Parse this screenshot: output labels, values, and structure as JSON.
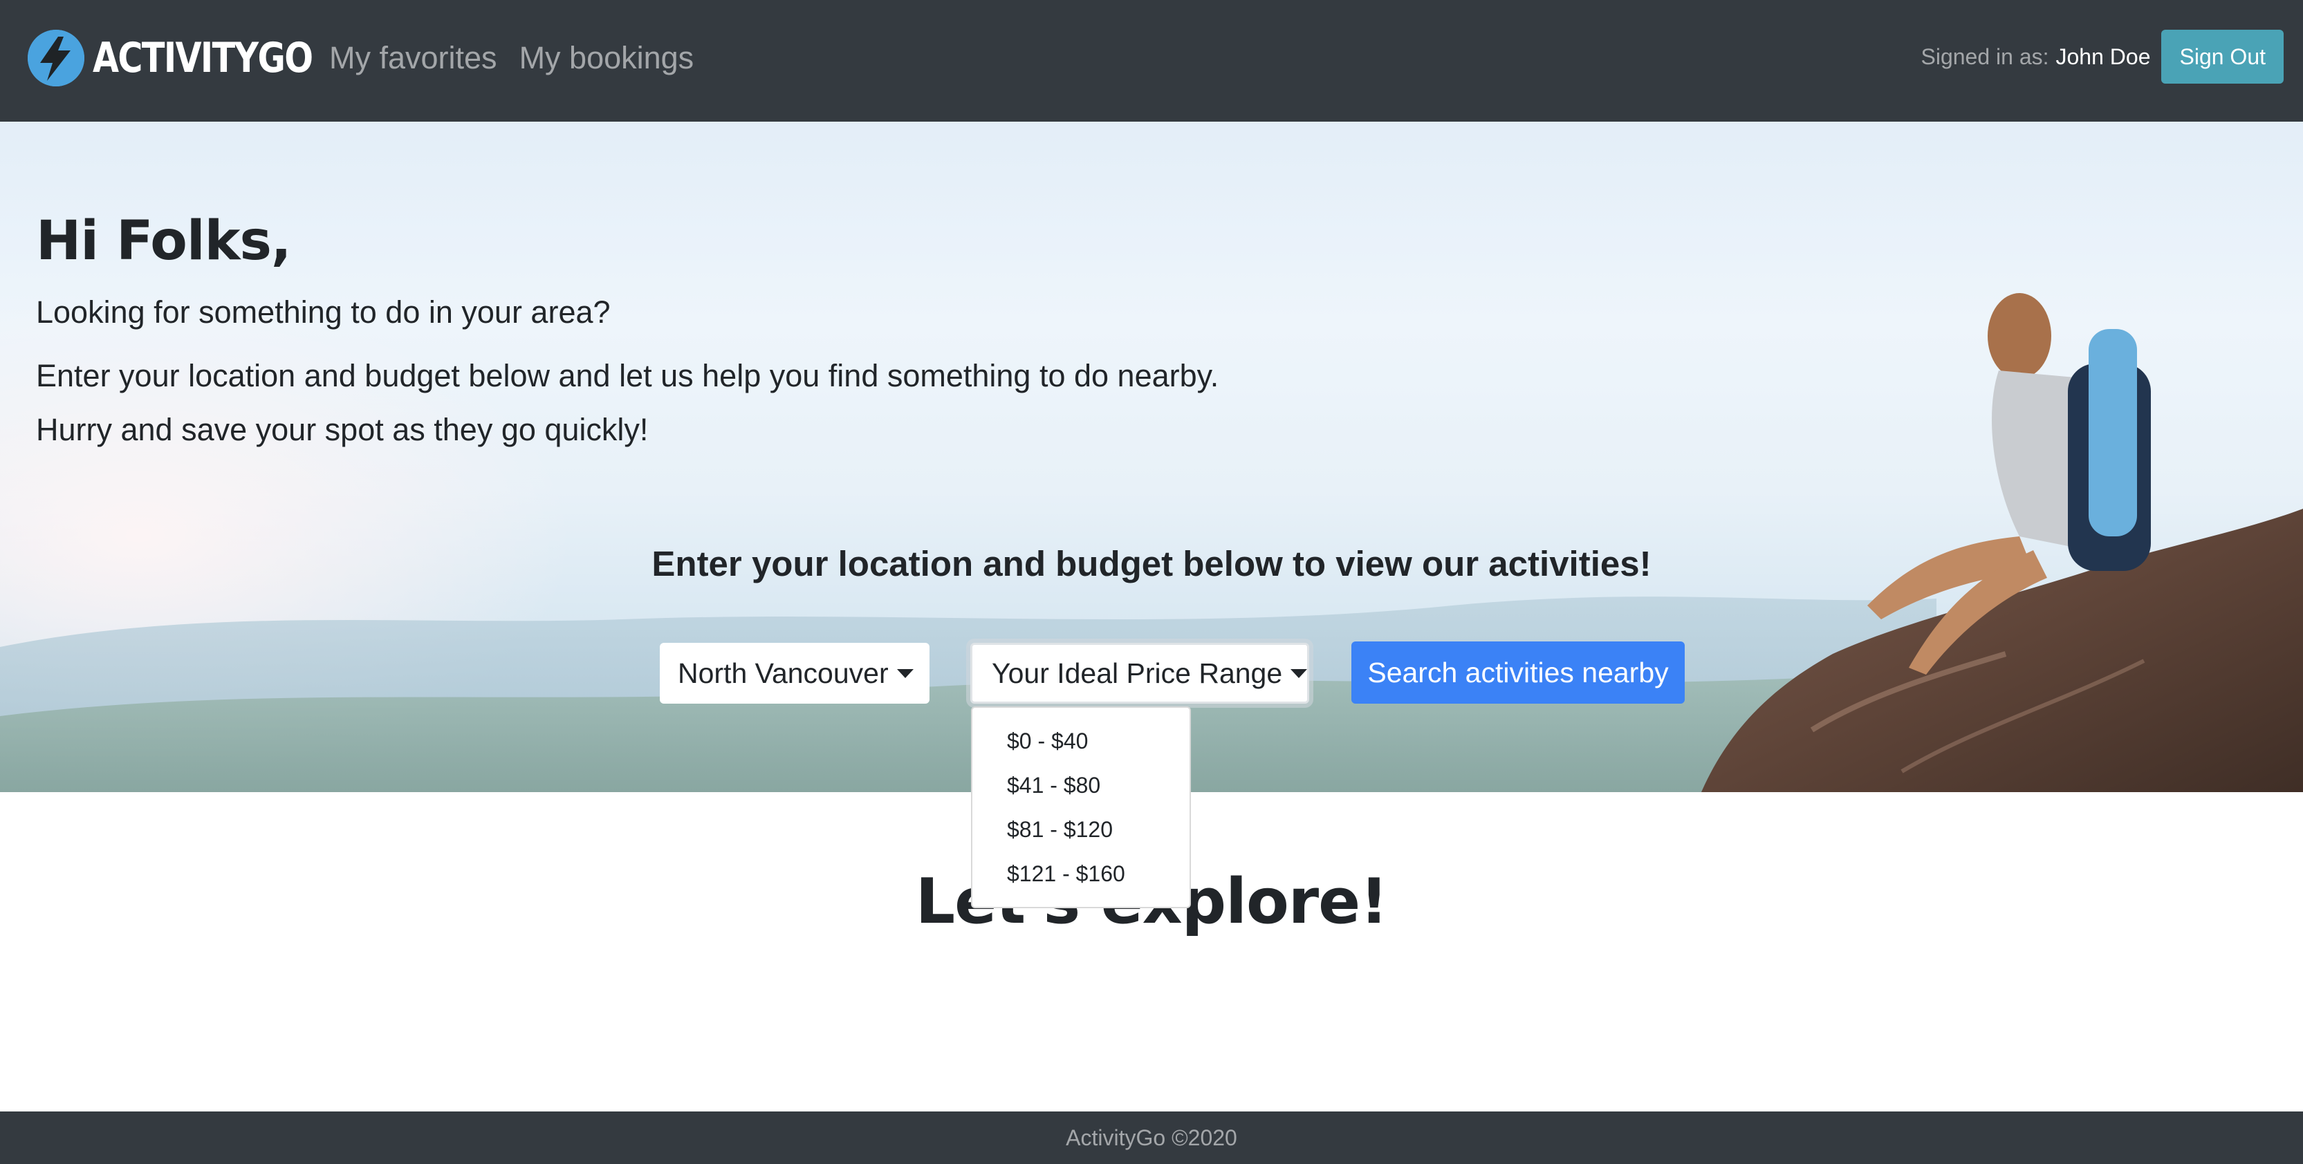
{
  "navbar": {
    "brand": "ACTIVITYGO",
    "links": [
      "My favorites",
      "My bookings"
    ],
    "signed_in_label": "Signed in as:",
    "user_name": "John Doe",
    "sign_out_label": "Sign Out"
  },
  "hero": {
    "title": "Hi Folks,",
    "subtitle": "Looking for something to do in your area?",
    "paragraph_1": "Enter your location and budget below and let us help you find something to do nearby.",
    "paragraph_2": "Hurry and save your spot as they go quickly!",
    "search_heading": "Enter your location and budget below to view our activities!"
  },
  "search": {
    "location_selected": "North Vancouver",
    "price_placeholder": "Your Ideal Price Range",
    "price_options": [
      "$0 - $40",
      "$41 - $80",
      "$81 - $120",
      "$121 - $160"
    ],
    "price_menu_open": true,
    "search_button_label": "Search activities nearby"
  },
  "main": {
    "explore_title": "Let's explore!"
  },
  "footer": {
    "text": "ActivityGo ©2020"
  },
  "colors": {
    "navbar_bg": "#343a40",
    "brand_accent": "#4aa3df",
    "sign_out_button": "#4aa3b6",
    "search_button": "#3b82f6",
    "footer_bg": "#343a40"
  },
  "icons": {
    "brand_logo": "lightning-bolt-icon"
  }
}
